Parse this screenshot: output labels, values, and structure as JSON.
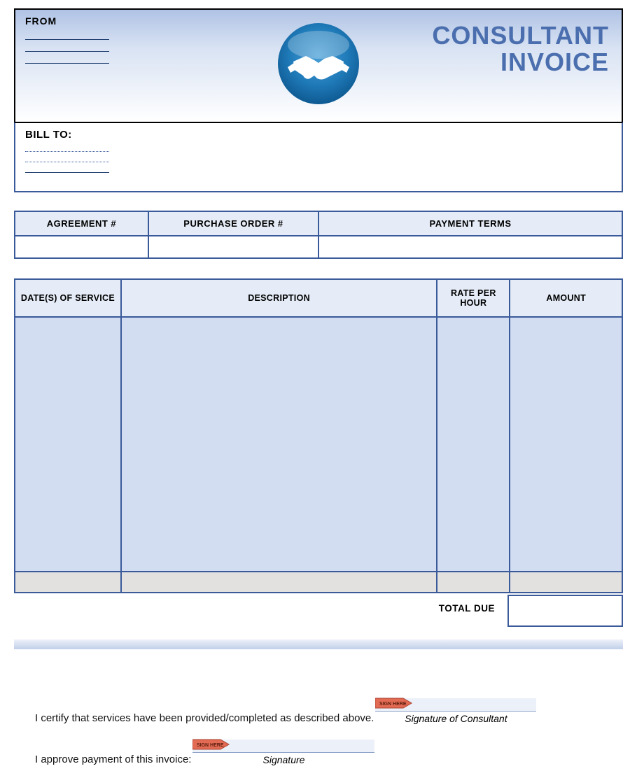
{
  "header": {
    "from_label": "FROM",
    "title_line1": "CONSULTANT",
    "title_line2": "INVOICE"
  },
  "billto": {
    "label": "BILL TO:"
  },
  "meta_headers": {
    "agreement": "AGREEMENT #",
    "po": "PURCHASE ORDER #",
    "terms": "PAYMENT TERMS"
  },
  "meta_values": {
    "agreement": "",
    "po": "",
    "terms": ""
  },
  "line_headers": {
    "date": "DATE(S) OF SERVICE",
    "desc": "DESCRIPTION",
    "rate": "RATE PER HOUR",
    "amount": "AMOUNT"
  },
  "totals": {
    "label": "TOTAL DUE",
    "value": ""
  },
  "sign": {
    "certify": "I certify that services have been provided/completed as described above.",
    "consultant_caption": "Signature of Consultant",
    "approve": "I approve payment of this invoice:",
    "approve_caption": "Signature",
    "badge": "SIGN HERE"
  }
}
